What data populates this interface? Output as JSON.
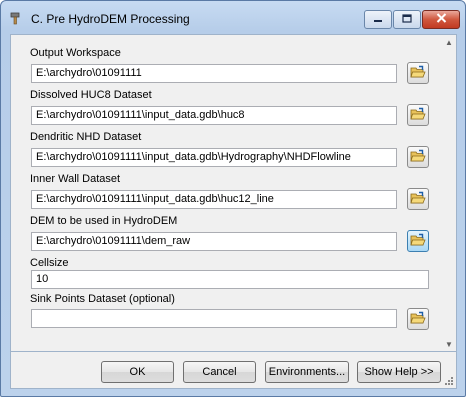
{
  "window": {
    "title": "C. Pre HydroDEM Processing"
  },
  "fields": [
    {
      "label": "Output Workspace",
      "value": "E:\\archydro\\01091111"
    },
    {
      "label": "Dissolved HUC8 Dataset",
      "value": "E:\\archydro\\01091111\\input_data.gdb\\huc8"
    },
    {
      "label": "Dendritic NHD Dataset",
      "value": "E:\\archydro\\01091111\\input_data.gdb\\Hydrography\\NHDFlowline"
    },
    {
      "label": "Inner Wall Dataset",
      "value": "E:\\archydro\\01091111\\input_data.gdb\\huc12_line"
    },
    {
      "label": "DEM to be used in HydroDEM",
      "value": "E:\\archydro\\01091111\\dem_raw"
    },
    {
      "label": "Cellsize",
      "value": "10"
    },
    {
      "label": "Sink Points Dataset (optional)",
      "value": ""
    }
  ],
  "buttons": {
    "ok": "OK",
    "cancel": "Cancel",
    "environments": "Environments...",
    "show_help": "Show Help >>"
  },
  "icons": {
    "app": "hammer-tool-icon",
    "browse": "open-folder-icon"
  },
  "colors": {
    "title_bar": "#bcd2ec",
    "close_button": "#c13a22",
    "dialog_bg": "#f0f0f0"
  }
}
